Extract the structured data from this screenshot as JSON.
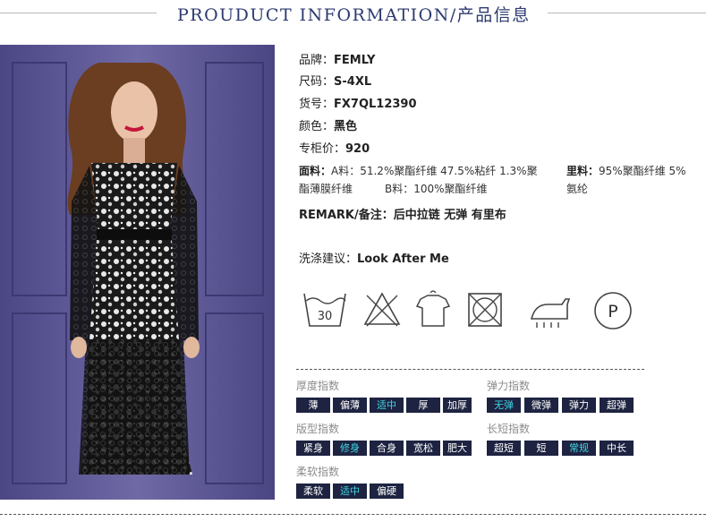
{
  "header": {
    "title": "PROUDUCT INFORMATION/产品信息"
  },
  "product": {
    "brand_label": "品牌：",
    "brand": "FEMLY",
    "size_label": "尺码：",
    "size": "S-4XL",
    "sku_label": "货号：",
    "sku": "FX7QL12390",
    "color_label": "颜色：",
    "color": "黑色",
    "price_label": "专柜价：",
    "price": "920"
  },
  "fabric": {
    "label": "面料：",
    "a_line1": "A料：51.2%聚酯纤维 47.5%粘纤 1.3%聚",
    "a_line2": "酯薄膜纤维",
    "b": "B料：100%聚酯纤维",
    "lining_label": "里料：",
    "lining_line1": "95%聚酯纤维 5%",
    "lining_line2": "氨纶"
  },
  "remark": {
    "label": "REMARK/备注：",
    "value": "后中拉链 无弹 有里布"
  },
  "care": {
    "label": "洗涤建议：",
    "value": "Look After Me",
    "icons": [
      "wash-30-icon",
      "no-bleach-icon",
      "no-tumble-dry-icon",
      "no-machine-dry-icon",
      "iron-steam-icon",
      "dry-clean-p-icon"
    ],
    "wash_temp": "30",
    "dryclean_letter": "P"
  },
  "indices": {
    "thickness": {
      "title": "厚度指数",
      "options": [
        "薄",
        "偏薄",
        "适中",
        "厚",
        "加厚"
      ],
      "selected": "适中"
    },
    "elasticity": {
      "title": "弹力指数",
      "options": [
        "无弹",
        "微弹",
        "弹力",
        "超弹"
      ],
      "selected": "无弹"
    },
    "fit": {
      "title": "版型指数",
      "options": [
        "紧身",
        "修身",
        "合身",
        "宽松",
        "肥大"
      ],
      "selected": "修身"
    },
    "length": {
      "title": "长短指数",
      "options": [
        "超短",
        "短",
        "常规",
        "中长"
      ],
      "selected": "常规"
    },
    "softness": {
      "title": "柔软指数",
      "options": [
        "柔软",
        "适中",
        "偏硬"
      ],
      "selected": "适中"
    }
  },
  "colors": {
    "chip_bg": "#1e2341",
    "chip_text": "#ffffff",
    "chip_selected": "#3fd6e4",
    "title": "#2c3a6e"
  }
}
